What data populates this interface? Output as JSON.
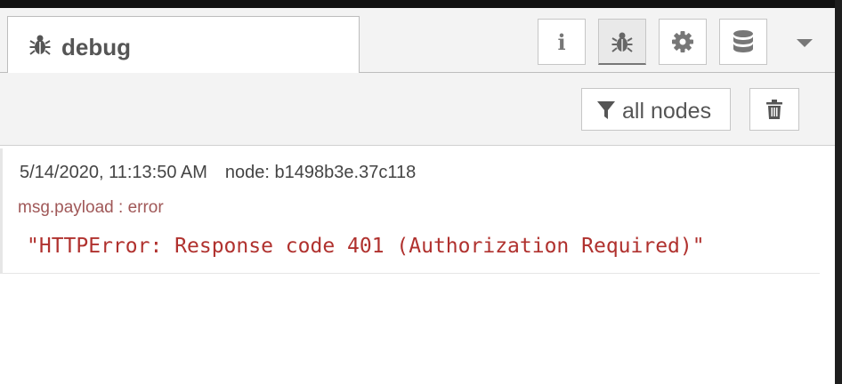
{
  "sidebar": {
    "tab": {
      "label": "debug",
      "icon": "bug-icon"
    },
    "buttons": [
      {
        "name": "info",
        "icon": "info-icon",
        "glyph": "i"
      },
      {
        "name": "debug",
        "icon": "bug-icon",
        "selected": true
      },
      {
        "name": "config",
        "icon": "gear-icon"
      },
      {
        "name": "context",
        "icon": "database-icon"
      }
    ],
    "menu_icon": "caret-down-icon"
  },
  "toolbar": {
    "filter_label": "all nodes",
    "filter_icon": "filter-icon",
    "clear_icon": "trash-icon"
  },
  "messages": [
    {
      "timestamp": "5/14/2020, 11:13:50 AM",
      "node": "node: b1498b3e.37c118",
      "topic": "msg.payload : error",
      "payload": "\"HTTPError: Response code 401 (Authorization Required)\""
    }
  ],
  "colors": {
    "payload_error": "#b0312e",
    "topic": "#a05858",
    "panel_bg": "#f3f3f3"
  }
}
